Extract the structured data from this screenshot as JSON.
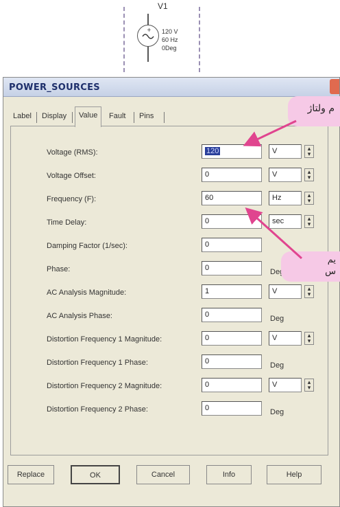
{
  "schematic": {
    "component_name": "V1",
    "voltage_label": "120 V",
    "frequency_label": "60 Hz",
    "phase_label": "0Deg"
  },
  "dialog": {
    "title": "POWER_SOURCES",
    "tabs": [
      {
        "label": "Label",
        "active": false
      },
      {
        "label": "Display",
        "active": false
      },
      {
        "label": "Value",
        "active": true
      },
      {
        "label": "Fault",
        "active": false
      },
      {
        "label": "Pins",
        "active": false
      }
    ],
    "fields": [
      {
        "label": "Voltage (RMS):",
        "value": "120",
        "unit": "V",
        "unit_type": "select"
      },
      {
        "label": "Voltage Offset:",
        "value": "0",
        "unit": "V",
        "unit_type": "select"
      },
      {
        "label": "Frequency (F):",
        "value": "60",
        "unit": "Hz",
        "unit_type": "select"
      },
      {
        "label": "Time Delay:",
        "value": "0",
        "unit": "sec",
        "unit_type": "select"
      },
      {
        "label": "Damping Factor (1/sec):",
        "value": "0",
        "unit": "",
        "unit_type": "none"
      },
      {
        "label": "Phase:",
        "value": "0",
        "unit": "Deg",
        "unit_type": "text"
      },
      {
        "label": "AC Analysis Magnitude:",
        "value": "1",
        "unit": "V",
        "unit_type": "select"
      },
      {
        "label": "AC Analysis Phase:",
        "value": "0",
        "unit": "Deg",
        "unit_type": "text"
      },
      {
        "label": "Distortion Frequency 1 Magnitude:",
        "value": "0",
        "unit": "V",
        "unit_type": "select"
      },
      {
        "label": "Distortion Frequency 1 Phase:",
        "value": "0",
        "unit": "Deg",
        "unit_type": "text"
      },
      {
        "label": "Distortion Frequency 2 Magnitude:",
        "value": "0",
        "unit": "V",
        "unit_type": "select"
      },
      {
        "label": "Distortion Frequency 2 Phase:",
        "value": "0",
        "unit": "Deg",
        "unit_type": "text"
      }
    ],
    "buttons": {
      "replace": "Replace",
      "ok": "OK",
      "cancel": "Cancel",
      "info": "Info",
      "help": "Help"
    }
  },
  "callouts": {
    "voltage_note": "م ولتاژ",
    "frequency_note_line1": "يم",
    "frequency_note_line2": "س"
  },
  "colors": {
    "dialog_bg": "#ece9d8",
    "title_text": "#1e2f6b",
    "callout_bg": "#f6c9e6",
    "arrow": "#e0458f",
    "selection": "#2a3f9a"
  }
}
